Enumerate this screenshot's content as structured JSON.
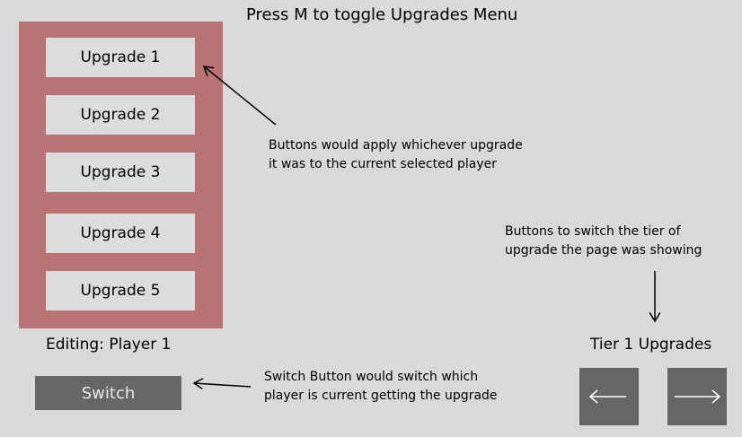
{
  "header": {
    "title": "Press M to toggle Upgrades Menu"
  },
  "upgrades_panel": {
    "buttons": [
      {
        "label": "Upgrade 1"
      },
      {
        "label": "Upgrade 2"
      },
      {
        "label": "Upgrade 3"
      },
      {
        "label": "Upgrade 4"
      },
      {
        "label": "Upgrade 5"
      }
    ]
  },
  "player": {
    "editing_label": "Editing: Player 1",
    "switch_label": "Switch"
  },
  "tier": {
    "label": "Tier 1 Upgrades",
    "prev_icon": "arrow-left-icon",
    "next_icon": "arrow-right-icon"
  },
  "annotations": {
    "upgrade_note_line1": "Buttons would apply whichever upgrade",
    "upgrade_note_line2": "it was to the current selected player",
    "tier_note_line1": "Buttons to switch the tier of",
    "tier_note_line2": "upgrade the page was showing",
    "switch_note_line1": "Switch Button would switch which",
    "switch_note_line2": "player is current getting the upgrade"
  },
  "colors": {
    "background": "#d9d9d9",
    "panel": "#b87474",
    "button": "#dcdcdc",
    "dark_button": "#666666"
  }
}
